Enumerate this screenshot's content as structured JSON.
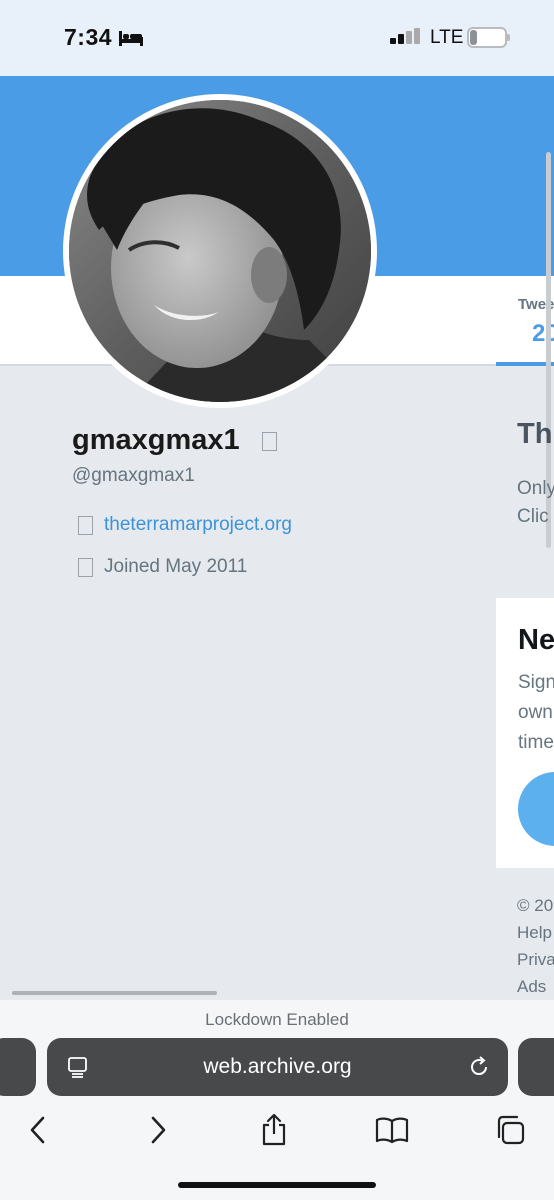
{
  "status_bar": {
    "time": "7:34",
    "network": "LTE",
    "battery_level": "3",
    "battery_fraction": 0.22
  },
  "profile": {
    "name": "gmaxgmax1",
    "handle": "@gmaxgmax1",
    "website": "theterramarproject.org",
    "joined": "Joined May 2011"
  },
  "nav": {
    "tab_label": "Twee",
    "tab_count": "20"
  },
  "right_column": {
    "title": "Th",
    "line1": "Only",
    "line2": "Clic",
    "new_title": "Ne",
    "new_line1": "Sign",
    "new_line2": "own",
    "new_line3": "time",
    "footer": [
      "© 20",
      "Help",
      "Priva",
      "Ads"
    ]
  },
  "browser": {
    "lockdown_label": "Lockdown Enabled",
    "url": "web.archive.org"
  },
  "colors": {
    "banner": "#4a9ce6",
    "link": "#3b94d9",
    "background": "#e6e9ee"
  },
  "icons": [
    "bed-icon",
    "signal-icon",
    "battery-icon",
    "website-link-icon",
    "calendar-icon",
    "page-menu-icon",
    "reload-icon",
    "back-icon",
    "forward-icon",
    "share-icon",
    "bookmarks-icon",
    "tabs-icon"
  ]
}
